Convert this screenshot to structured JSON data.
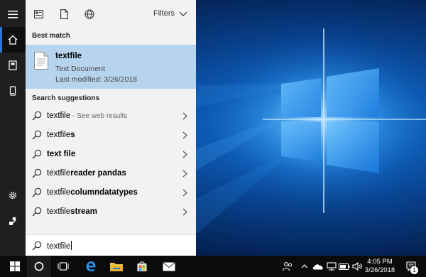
{
  "search_panel": {
    "filters_label": "Filters",
    "best_match_heading": "Best match",
    "best_match": {
      "name": "textfile",
      "type": "Text Document",
      "modified": "Last modified: 3/26/2018"
    },
    "suggestions_heading": "Search suggestions",
    "suggestions": [
      {
        "prefix": "textfile",
        "rest": "",
        "sub": " - See web results"
      },
      {
        "prefix": "textfile",
        "rest": "s",
        "sub": ""
      },
      {
        "prefix": "",
        "rest": "text file",
        "sub": ""
      },
      {
        "prefix": "textfile",
        "rest": "reader pandas",
        "sub": ""
      },
      {
        "prefix": "textfile",
        "rest": "columndatatypes",
        "sub": ""
      },
      {
        "prefix": "textfile",
        "rest": "stream",
        "sub": ""
      }
    ]
  },
  "search_box": {
    "query": "textfile"
  },
  "taskbar": {
    "time": "4:05 PM",
    "date": "3/26/2018",
    "notification_count": "1"
  },
  "colors": {
    "accent": "#2b79d6",
    "best_match_bg": "#b7d4ee",
    "rail_bg": "#1f1f1f",
    "panel_bg": "#f2f2f2"
  }
}
